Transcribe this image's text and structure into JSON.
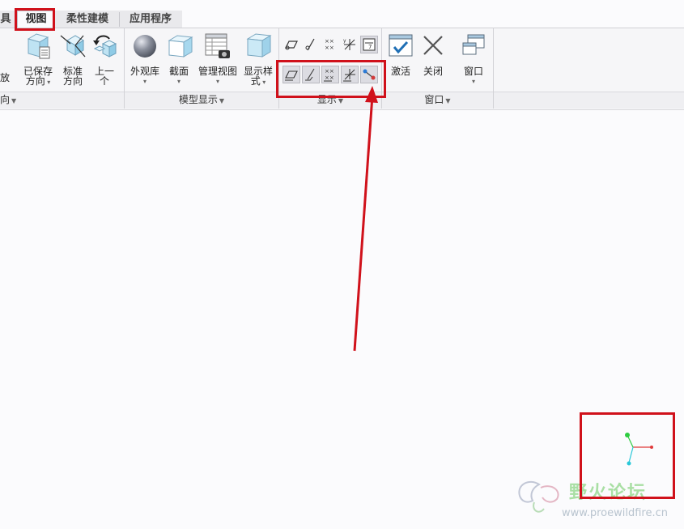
{
  "tabs": [
    {
      "label": "具",
      "active": false
    },
    {
      "label": "视图",
      "active": true
    },
    {
      "label": "柔性建模",
      "active": false
    },
    {
      "label": "应用程序",
      "active": false
    }
  ],
  "ribbon": {
    "orientation": {
      "partial_left_label": "放",
      "saved_views_line1": "已保存",
      "saved_views_line2": "方向",
      "standard_line1": "标准",
      "standard_line2": "方向",
      "previous_line1": "上一",
      "previous_line2": "个",
      "group_label": "向"
    },
    "model_display": {
      "appearance_gallery": "外观库",
      "section": "截面",
      "manage_views": "管理视图",
      "display_style_line1": "显示样",
      "display_style_line2": "式",
      "group_label": "模型显示"
    },
    "show": {
      "group_label": "显示"
    },
    "window": {
      "activate": "激活",
      "close": "关闭",
      "windows": "窗口",
      "group_label": "窗口"
    }
  },
  "watermark": {
    "title": "野火论坛",
    "url": "www.proewildfire.cn"
  },
  "colors": {
    "highlight": "#d0111b",
    "axis_x": "#e03a3a",
    "axis_y": "#2ecc40",
    "axis_z": "#29c7d8"
  }
}
